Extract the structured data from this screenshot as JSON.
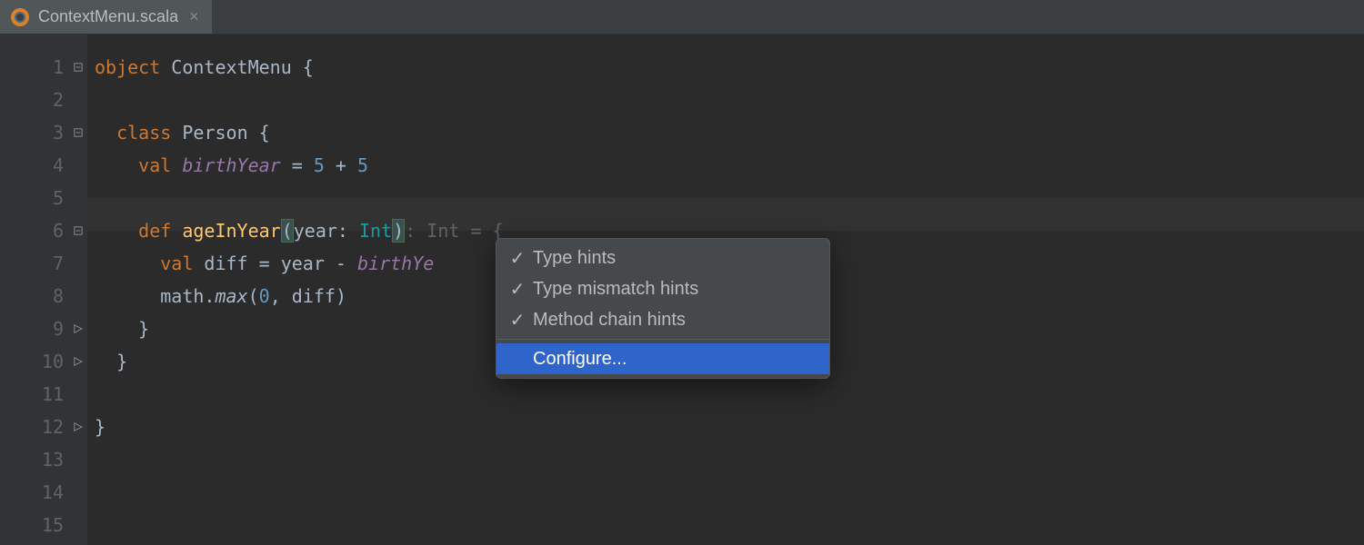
{
  "tab": {
    "filename": "ContextMenu.scala"
  },
  "gutter": {
    "lines": [
      "1",
      "2",
      "3",
      "4",
      "5",
      "6",
      "7",
      "8",
      "9",
      "10",
      "11",
      "12",
      "13",
      "14",
      "15"
    ]
  },
  "code": {
    "l1": {
      "kw": "object",
      "name": "ContextMenu",
      "brace": " {"
    },
    "l3": {
      "kw": "class",
      "name": "Person",
      "brace": " {"
    },
    "l4": {
      "kw": "val",
      "name": "birthYear",
      "eq": " = ",
      "n1": "5",
      "op": " + ",
      "n2": "5"
    },
    "l6": {
      "kw": "def",
      "name": "ageInYear",
      "lp": "(",
      "param": "year: ",
      "type": "Int",
      "rp": ")",
      "colon": ": ",
      "rtype": "Int",
      "eq": " = {"
    },
    "l7": {
      "kw": "val",
      "name": "diff",
      "eq": " = ",
      "v1": "year",
      "op": " - ",
      "v2": "birthYe"
    },
    "l8": {
      "obj": "math",
      "dot": ".",
      "method": "max",
      "lp": "(",
      "n1": "0",
      "comma": ", ",
      "v1": "diff",
      "rp": ")"
    },
    "l9": {
      "brace": "}"
    },
    "l10": {
      "brace": "}"
    },
    "l12": {
      "brace": "}"
    }
  },
  "menu": {
    "items": [
      {
        "checked": true,
        "label": "Type hints"
      },
      {
        "checked": true,
        "label": "Type mismatch hints"
      },
      {
        "checked": true,
        "label": "Method chain hints"
      }
    ],
    "configure": "Configure..."
  },
  "highlighted_line_index": 5
}
